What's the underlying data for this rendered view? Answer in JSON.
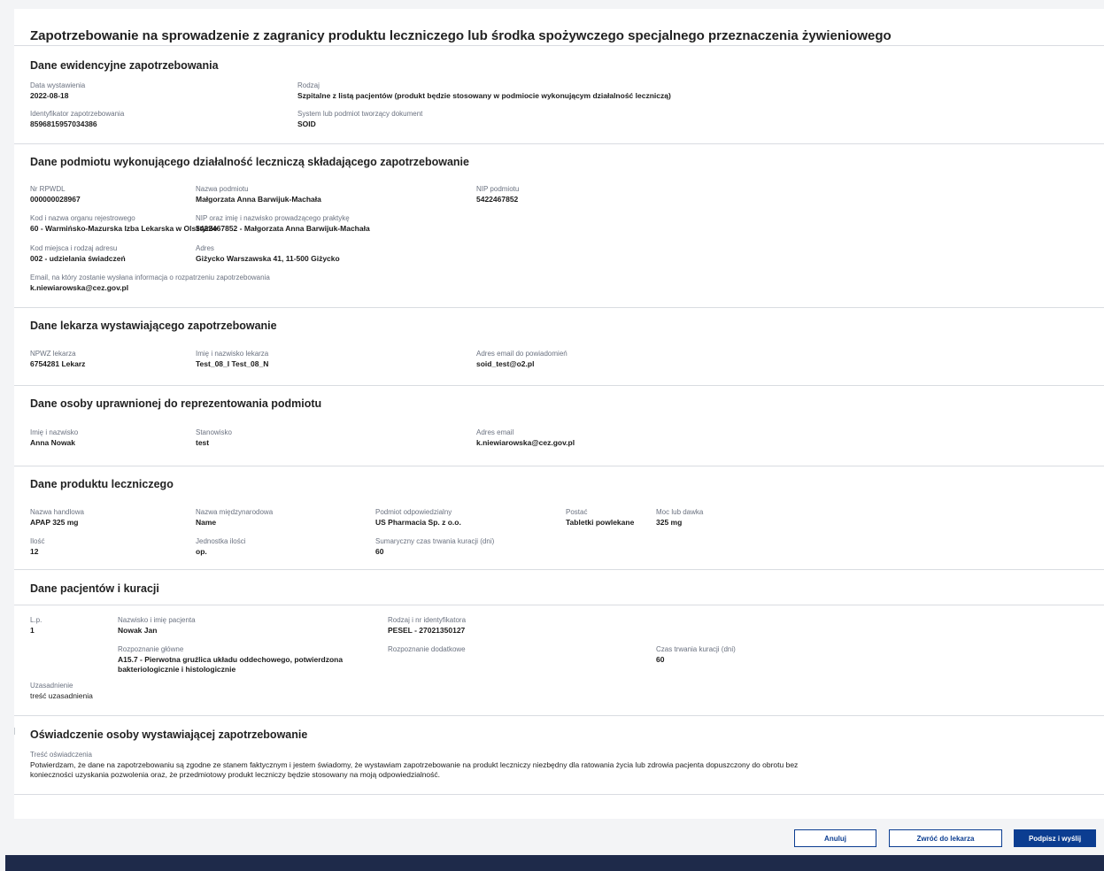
{
  "title": "Zapotrzebowanie na sprowadzenie z zagranicy produktu leczniczego lub środka spożywczego specjalnego przeznaczenia żywieniowego",
  "s1": {
    "heading": "Dane ewidencyjne zapotrzebowania",
    "fields": [
      {
        "label": "Data wystawienia",
        "value": "2022-08-18"
      },
      {
        "label": "Rodzaj",
        "value": "Szpitalne z listą pacjentów (produkt będzie stosowany w podmiocie wykonującym działalność leczniczą)"
      },
      {
        "label": "Identyfikator zapotrzebowania",
        "value": "8596815957034386"
      },
      {
        "label": "System lub podmiot tworzący dokument",
        "value": "SOID"
      }
    ]
  },
  "s2": {
    "heading": "Dane podmiotu wykonującego działalność leczniczą składającego zapotrzebowanie",
    "fields": [
      {
        "label": "Nr RPWDL",
        "value": "000000028967"
      },
      {
        "label": "Nazwa podmiotu",
        "value": "Małgorzata Anna Barwijuk-Machała"
      },
      {
        "label": "NIP podmiotu",
        "value": "5422467852"
      },
      {
        "label": "Kod i nazwa organu rejestrowego",
        "value": "60 - Warmińsko-Mazurska Izba Lekarska w Olsztynie"
      },
      {
        "label": "NIP oraz imię i nazwisko prowadzącego praktykę",
        "value": "5422467852 - Małgorzata Anna Barwijuk-Machała"
      },
      {
        "label": "Kod miejsca i rodzaj adresu",
        "value": "002 - udzielania świadczeń"
      },
      {
        "label": "Adres",
        "value": "Giżycko Warszawska 41, 11-500 Giżycko"
      },
      {
        "label": "Email, na który zostanie wysłana informacja o rozpatrzeniu zapotrzebowania",
        "value": "k.niewiarowska@cez.gov.pl"
      }
    ]
  },
  "s3": {
    "heading": "Dane lekarza wystawiającego zapotrzebowanie",
    "fields": [
      {
        "label": "NPWZ lekarza",
        "value": "6754281 Lekarz"
      },
      {
        "label": "Imię i nazwisko lekarza",
        "value": "Test_08_I Test_08_N"
      },
      {
        "label": "Adres email do powiadomień",
        "value": "soid_test@o2.pl"
      }
    ]
  },
  "s4": {
    "heading": "Dane osoby uprawnionej do reprezentowania podmiotu",
    "fields": [
      {
        "label": "Imię i nazwisko",
        "value": "Anna Nowak"
      },
      {
        "label": "Stanowisko",
        "value": "test"
      },
      {
        "label": "Adres email",
        "value": "k.niewiarowska@cez.gov.pl"
      }
    ]
  },
  "s5": {
    "heading": "Dane produktu leczniczego",
    "fields": [
      {
        "label": "Nazwa handlowa",
        "value": "APAP 325 mg"
      },
      {
        "label": "Nazwa międzynarodowa",
        "value": "Name"
      },
      {
        "label": "Podmiot odpowiedzialny",
        "value": "US Pharmacia Sp. z o.o."
      },
      {
        "label": "Postać",
        "value": "Tabletki powlekane"
      },
      {
        "label": "Moc lub dawka",
        "value": "325 mg"
      },
      {
        "label": "Ilość",
        "value": "12"
      },
      {
        "label": "Jednostka ilości",
        "value": "op."
      },
      {
        "label": "Sumaryczny czas trwania kuracji (dni)",
        "value": "60"
      }
    ]
  },
  "s6": {
    "heading": "Dane pacjentów i kuracji",
    "fields": [
      {
        "label": "L.p.",
        "value": "1"
      },
      {
        "label": "Nazwisko i imię pacjenta",
        "value": "Nowak Jan"
      },
      {
        "label": "Rodzaj i nr identyfikatora",
        "value": "PESEL - 27021350127"
      },
      {
        "label": "Rozpoznanie główne",
        "value": "A15.7 - Pierwotna gruźlica układu oddechowego, potwierdzona bakteriologicznie i histologicznie"
      },
      {
        "label": "Rozpoznanie dodatkowe",
        "value": ""
      },
      {
        "label": "Czas trwania kuracji (dni)",
        "value": "60"
      },
      {
        "label": "Uzasadnienie",
        "value": "treść uzasadnienia"
      }
    ]
  },
  "s7": {
    "heading": "Oświadczenie osoby wystawiającej zapotrzebowanie",
    "label": "Treść oświadczenia",
    "line1": "Potwierdzam, że dane na zapotrzebowaniu są zgodne ze stanem faktycznym i jestem świadomy, że wystawiam zapotrzebowanie na produkt leczniczy niezbędny dla ratowania życia lub zdrowia pacjenta dopuszczony do obrotu bez",
    "line2": "konieczności uzyskania pozwolenia oraz, że przedmiotowy produkt leczniczy będzie stosowany na moją odpowiedzialność."
  },
  "buttons": {
    "cancel": "Anuluj",
    "return": "Zwróć do lekarza",
    "sign": "Podpisz i wyślij"
  }
}
